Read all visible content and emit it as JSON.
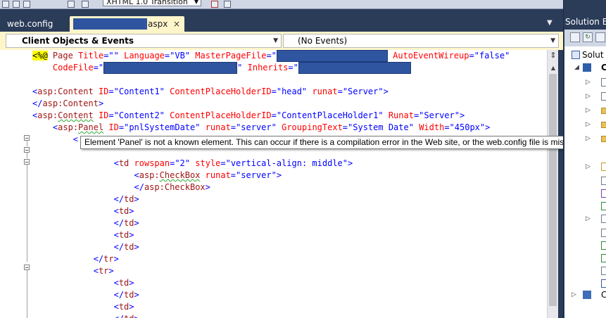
{
  "toolbar": {
    "doctype_selector": "XHTML 1.0 Transition"
  },
  "tabs": [
    {
      "label": "web.config"
    },
    {
      "label": "aspx",
      "close": "×"
    }
  ],
  "nav": {
    "objects": "Client Objects & Events",
    "events": "(No Events)"
  },
  "code": {
    "l1": {
      "open": "<%@",
      "directive": "Page",
      "a1": "Title",
      "v1": "\"\"",
      "a2": "Language",
      "v2": "\"VB\"",
      "a3": "MasterPageFile",
      "v3": "=\"",
      "a4": "AutoEventWireup",
      "v4": "\"false\""
    },
    "l2": {
      "a1": "CodeFile",
      "v1": "=\"",
      "v1end": "\"",
      "a2": "Inherits",
      "v2": "=\""
    },
    "l3": {
      "tag": "asp:Content",
      "a1": "ID",
      "v1": "\"Content1\"",
      "a2": "ContentPlaceHolderID",
      "v2": "\"head\"",
      "a3": "runat",
      "v3": "\"Server\""
    },
    "l4": {
      "tag": "asp:Content"
    },
    "l5": {
      "tag_ns": "asp:",
      "tag_name": "Content",
      "a1": "ID",
      "v1": "\"Content2\"",
      "a2": "ContentPlaceHolderID",
      "v2": "\"ContentPlaceHolder1\"",
      "a3": "Runat",
      "v3": "\"Server\""
    },
    "l6": {
      "tag_ns": "asp:",
      "tag_name": "Panel",
      "a1": "ID",
      "v1": "\"pnlSystemDate\"",
      "a2": "runat",
      "v2": "\"server\"",
      "a3": "GroupingText",
      "v3": "\"System Date\"",
      "a4": "Width",
      "v4": "\"450px\""
    },
    "l9": {
      "tag": "td",
      "a1": "rowspan",
      "v1": "\"2\"",
      "a2": "style",
      "v2": "\"vertical-align: middle\""
    },
    "l10": {
      "tag_ns": "asp:",
      "tag_name": "CheckBox",
      "a1": "runat",
      "v1": "\"server\""
    },
    "l11": {
      "tag": "asp:CheckBox"
    },
    "td": "td",
    "tr": "tr"
  },
  "tooltip": "Element 'Panel' is not a known element. This can occur if there is a compilation error in the Web site, or the web.config file is missing.",
  "solution_explorer": {
    "title": "Solution Ex",
    "root_label": "Solut",
    "project_label": "C",
    "bottom_label": "C"
  },
  "colors": {
    "chrome": "#2b3c59",
    "active_tab": "#fff5cb",
    "tag": "#a31515",
    "attribute": "#ff0000",
    "value": "#0000ff",
    "redaction": "#2f55a0"
  }
}
